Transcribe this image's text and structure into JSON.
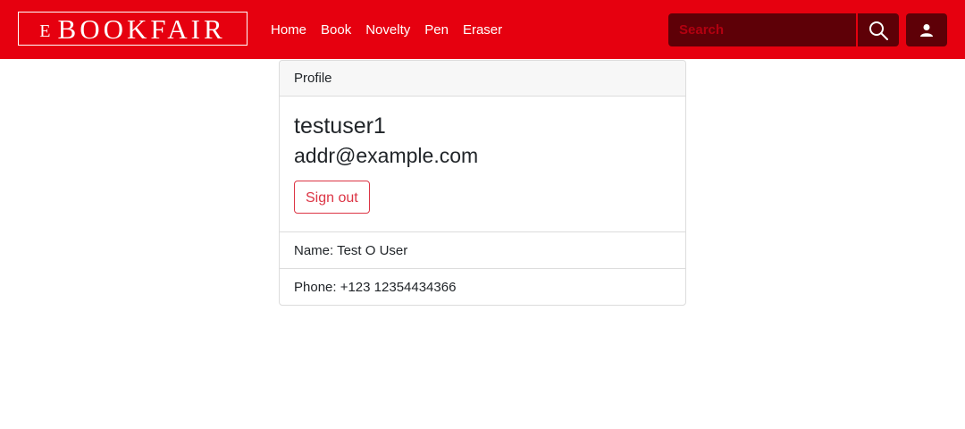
{
  "navbar": {
    "brand_prefix": "E",
    "brand_main": "BOOKFAIR",
    "links": [
      "Home",
      "Book",
      "Novelty",
      "Pen",
      "Eraser"
    ],
    "search_placeholder": "Search",
    "search_icon": "search-icon",
    "user_icon": "user-icon"
  },
  "profile": {
    "header": "Profile",
    "username": "testuser1",
    "email": "addr@example.com",
    "signout_label": "Sign out",
    "name_line": "Name: Test O User",
    "phone_line": "Phone: +123 12354434366"
  },
  "colors": {
    "navbar": "#e6000f",
    "dark_control": "#5e0007",
    "danger": "#dc3545"
  }
}
